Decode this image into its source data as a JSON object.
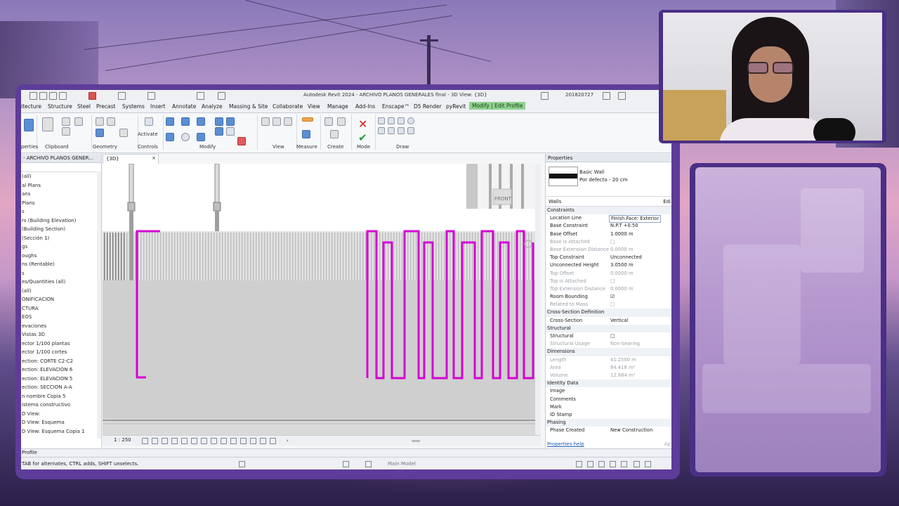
{
  "window_title": "Autodesk Revit 2024 - ARCHIVO PLANOS GENERALES final - 3D View: {3D}",
  "user": "201820727",
  "ribbon_tabs": [
    "itecture",
    "Structure",
    "Steel",
    "Precast",
    "Systems",
    "Insert",
    "Annotate",
    "Analyze",
    "Massing & Site",
    "Collaborate",
    "View",
    "Manage",
    "Add-Ins",
    "Enscape™",
    "D5 Render",
    "pyRevit",
    "Modify | Edit Profile"
  ],
  "ribbon_groups": {
    "properties": "perties",
    "clipboard": "Clipboard",
    "geometry": "Geometry",
    "controls": "Controls",
    "activate": "Activate",
    "modify": "Modify",
    "view": "View",
    "measure": "Measure",
    "create": "Create",
    "mode": "Mode",
    "draw": "Draw"
  },
  "project_browser": {
    "header": "- ARCHIVO PLANOS GENER...",
    "items": [
      "(all)",
      "al Plans",
      "ans",
      "Plans",
      "s",
      "rs (Building Elevation)",
      "(Building Section)",
      "(Sección 1)",
      "gs",
      "oughs",
      "ns (Rentable)",
      "s",
      "es/Quantities (all)",
      "(all)",
      "ONIFICACION",
      "CTURA",
      "EOS",
      "evaciones",
      "Vistas 3D",
      "ector 1/100 plantas",
      "ector 1/100 cortes",
      "ection: CORTE C2-C2",
      "ection: ELEVACION 6",
      "ection: ELEVACION 5",
      "ection: SECCION A-A",
      "n nombre Copia 5",
      "istema constructivo",
      "D View:",
      "D View: Esquema",
      "D View: Esquema Copia 1"
    ]
  },
  "view_tab": {
    "label": "{3D}",
    "close": "×"
  },
  "view_label": "FRONT",
  "view_scale": "1 : 250",
  "properties": {
    "header": "Properties",
    "type_name": "Basic Wall",
    "type_sub": "Por defecto - 20 cm",
    "selector": "Walls",
    "edit_type": "Edi",
    "help": "Properties help",
    "apply": "Ap",
    "rows": [
      {
        "k": "Constraints",
        "cat": true
      },
      {
        "k": "Location Line",
        "v": "Finish Face: Exterior",
        "box": true
      },
      {
        "k": "Base Constraint",
        "v": "N.P.T +0.50"
      },
      {
        "k": "Base Offset",
        "v": "1.0000 m"
      },
      {
        "k": "Base is Attached",
        "v": "□",
        "dim": true
      },
      {
        "k": "Base Extension Distance",
        "v": "0.0000 m",
        "dim": true
      },
      {
        "k": "Top Constraint",
        "v": "Unconnected"
      },
      {
        "k": "Unconnected Height",
        "v": "3.0500 m"
      },
      {
        "k": "Top Offset",
        "v": "0.0000 m",
        "dim": true
      },
      {
        "k": "Top is Attached",
        "v": "□",
        "dim": true
      },
      {
        "k": "Top Extension Distance",
        "v": "0.0000 m",
        "dim": true
      },
      {
        "k": "Room Bounding",
        "v": "☑"
      },
      {
        "k": "Related to Mass",
        "v": "□",
        "dim": true
      },
      {
        "k": "Cross-Section Definition",
        "cat": true
      },
      {
        "k": "Cross-Section",
        "v": "Vertical"
      },
      {
        "k": "Structural",
        "cat": true
      },
      {
        "k": "Structural",
        "v": "□"
      },
      {
        "k": "Structural Usage",
        "v": "Non-bearing",
        "dim": true
      },
      {
        "k": "Dimensions",
        "cat": true
      },
      {
        "k": "Length",
        "v": "41.2500 m",
        "dim": true
      },
      {
        "k": "Area",
        "v": "84.418 m²",
        "dim": true
      },
      {
        "k": "Volume",
        "v": "12.884 m³",
        "dim": true
      },
      {
        "k": "Identity Data",
        "cat": true
      },
      {
        "k": "Image",
        "v": ""
      },
      {
        "k": "Comments",
        "v": ""
      },
      {
        "k": "Mark",
        "v": ""
      },
      {
        "k": "ID Stamp",
        "v": ""
      },
      {
        "k": "Phasing",
        "cat": true
      },
      {
        "k": "Phase Created",
        "v": "New Construction"
      }
    ]
  },
  "status_mode": "Profile",
  "status_message": "TAB for alternates, CTRL adds, SHIFT unselects.",
  "status_model": "Main Model",
  "colors": {
    "sketch": "#d400d4",
    "accent": "#8fd28f"
  }
}
